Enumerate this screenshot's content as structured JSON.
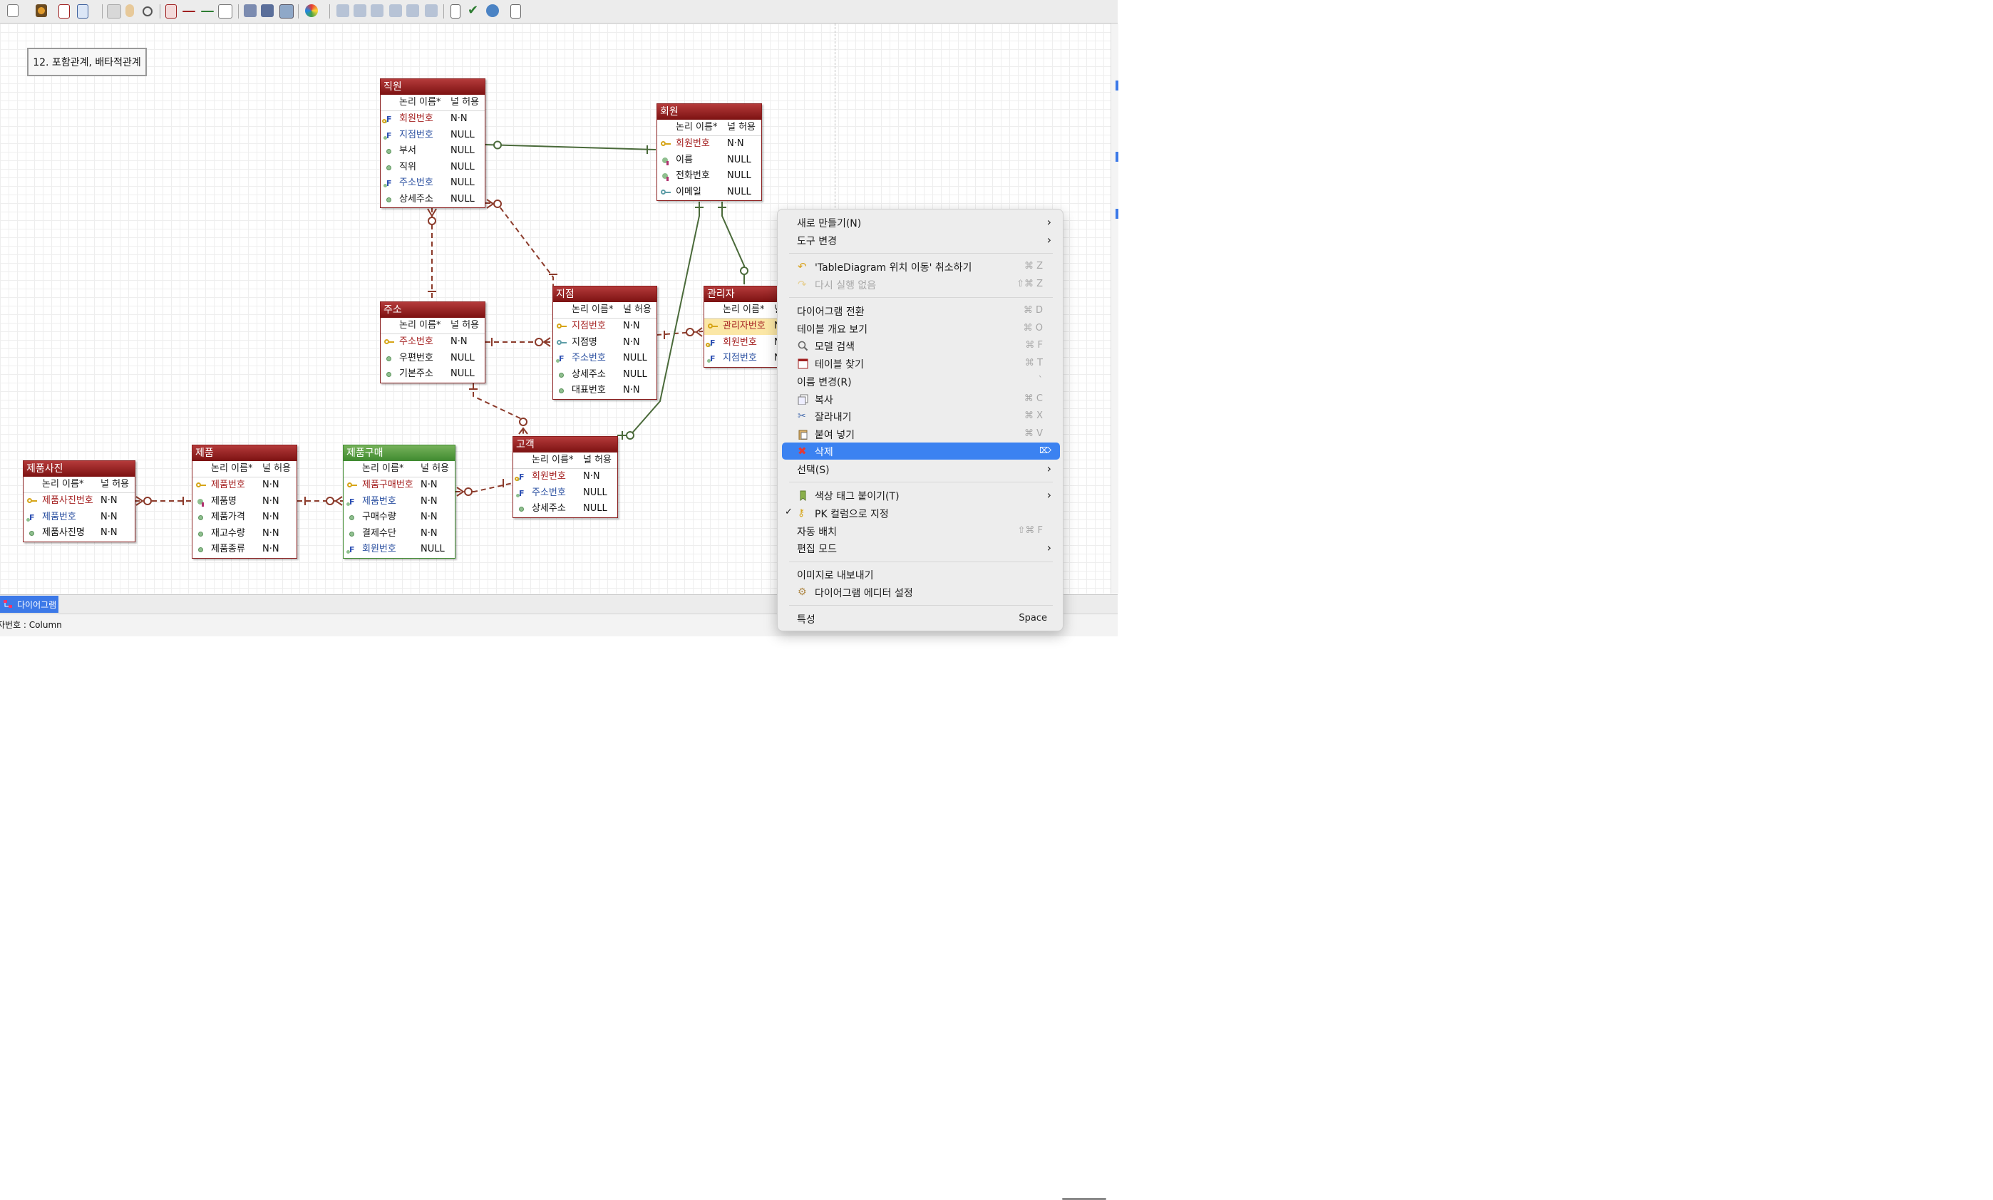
{
  "note": {
    "text": "12. 포함관계, 배타적관계"
  },
  "column_headers": {
    "name": "논리 이름*",
    "null": "널 허용"
  },
  "entities": {
    "employee": {
      "title": "직원",
      "columns": [
        {
          "name": "회원번호",
          "null": "N·N"
        },
        {
          "name": "지점번호",
          "null": "NULL"
        },
        {
          "name": "부서",
          "null": "NULL"
        },
        {
          "name": "직위",
          "null": "NULL"
        },
        {
          "name": "주소번호",
          "null": "NULL"
        },
        {
          "name": "상세주소",
          "null": "NULL"
        }
      ]
    },
    "member": {
      "title": "회원",
      "columns": [
        {
          "name": "회원번호",
          "null": "N·N"
        },
        {
          "name": "이름",
          "null": "NULL"
        },
        {
          "name": "전화번호",
          "null": "NULL"
        },
        {
          "name": "이메일",
          "null": "NULL"
        }
      ]
    },
    "address": {
      "title": "주소",
      "columns": [
        {
          "name": "주소번호",
          "null": "N·N"
        },
        {
          "name": "우편번호",
          "null": "NULL"
        },
        {
          "name": "기본주소",
          "null": "NULL"
        }
      ]
    },
    "branch": {
      "title": "지점",
      "columns": [
        {
          "name": "지점번호",
          "null": "N·N"
        },
        {
          "name": "지점명",
          "null": "N·N"
        },
        {
          "name": "주소번호",
          "null": "NULL"
        },
        {
          "name": "상세주소",
          "null": "NULL"
        },
        {
          "name": "대표번호",
          "null": "N·N"
        }
      ]
    },
    "manager": {
      "title": "관리자",
      "columns": [
        {
          "name": "관리자번호",
          "null": "N"
        },
        {
          "name": "회원번호",
          "null": "N"
        },
        {
          "name": "지점번호",
          "null": "N"
        }
      ]
    },
    "customer": {
      "title": "고객",
      "columns": [
        {
          "name": "회원번호",
          "null": "N·N"
        },
        {
          "name": "주소번호",
          "null": "NULL"
        },
        {
          "name": "상세주소",
          "null": "NULL"
        }
      ]
    },
    "product_photo": {
      "title": "제품사진",
      "columns": [
        {
          "name": "제품사진번호",
          "null": "N·N"
        },
        {
          "name": "제품번호",
          "null": "N·N"
        },
        {
          "name": "제품사진명",
          "null": "N·N"
        }
      ]
    },
    "product": {
      "title": "제품",
      "columns": [
        {
          "name": "제품번호",
          "null": "N·N"
        },
        {
          "name": "제품명",
          "null": "N·N"
        },
        {
          "name": "제품가격",
          "null": "N·N"
        },
        {
          "name": "재고수량",
          "null": "N·N"
        },
        {
          "name": "제품종류",
          "null": "N·N"
        }
      ]
    },
    "purchase": {
      "title": "제품구매",
      "columns": [
        {
          "name": "제품구매번호",
          "null": "N·N"
        },
        {
          "name": "제품번호",
          "null": "N·N"
        },
        {
          "name": "구매수량",
          "null": "N·N"
        },
        {
          "name": "결제수단",
          "null": "N·N"
        },
        {
          "name": "회원번호",
          "null": "NULL"
        }
      ]
    }
  },
  "context_menu": {
    "new": "새로 만들기(N)",
    "change_tool": "도구 변경",
    "undo": "'TableDiagram 위치 이동' 취소하기",
    "undo_shortcut": "⌘ Z",
    "redo": "다시 실행 없음",
    "redo_shortcut": "⇧⌘ Z",
    "switch_diagram": "다이어그램 전환",
    "switch_diagram_shortcut": "⌘ D",
    "table_overview": "테이블 개요 보기",
    "table_overview_shortcut": "⌘ O",
    "model_search": "모델 검색",
    "model_search_shortcut": "⌘ F",
    "find_table": "테이블 찾기",
    "find_table_shortcut": "⌘ T",
    "rename": "이름 변경(R)",
    "rename_shortcut": "`",
    "copy": "복사",
    "copy_shortcut": "⌘ C",
    "cut": "잘라내기",
    "cut_shortcut": "⌘ X",
    "paste": "붙여 넣기",
    "paste_shortcut": "⌘ V",
    "delete": "삭제",
    "select": "선택(S)",
    "color_tag": "색상 태그 붙이기(T)",
    "set_pk": "PK 컬럼으로 지정",
    "auto_layout": "자동 배치",
    "auto_layout_shortcut": "⇧⌘ F",
    "edit_mode": "편집 모드",
    "export_image": "이미지로 내보내기",
    "editor_settings": "다이어그램 에디터 설정",
    "properties": "특성",
    "properties_shortcut": "Space"
  },
  "bottom_tab": {
    "label": "다이어그램"
  },
  "status_bar": {
    "text": "자번호 : Column"
  },
  "colors": {
    "entity_red": "#8a1f1f",
    "entity_green": "#3f8a30",
    "relation_red": "#8b3a2a",
    "relation_green": "#4a6a3a",
    "menu_highlight": "#3b82f1"
  }
}
